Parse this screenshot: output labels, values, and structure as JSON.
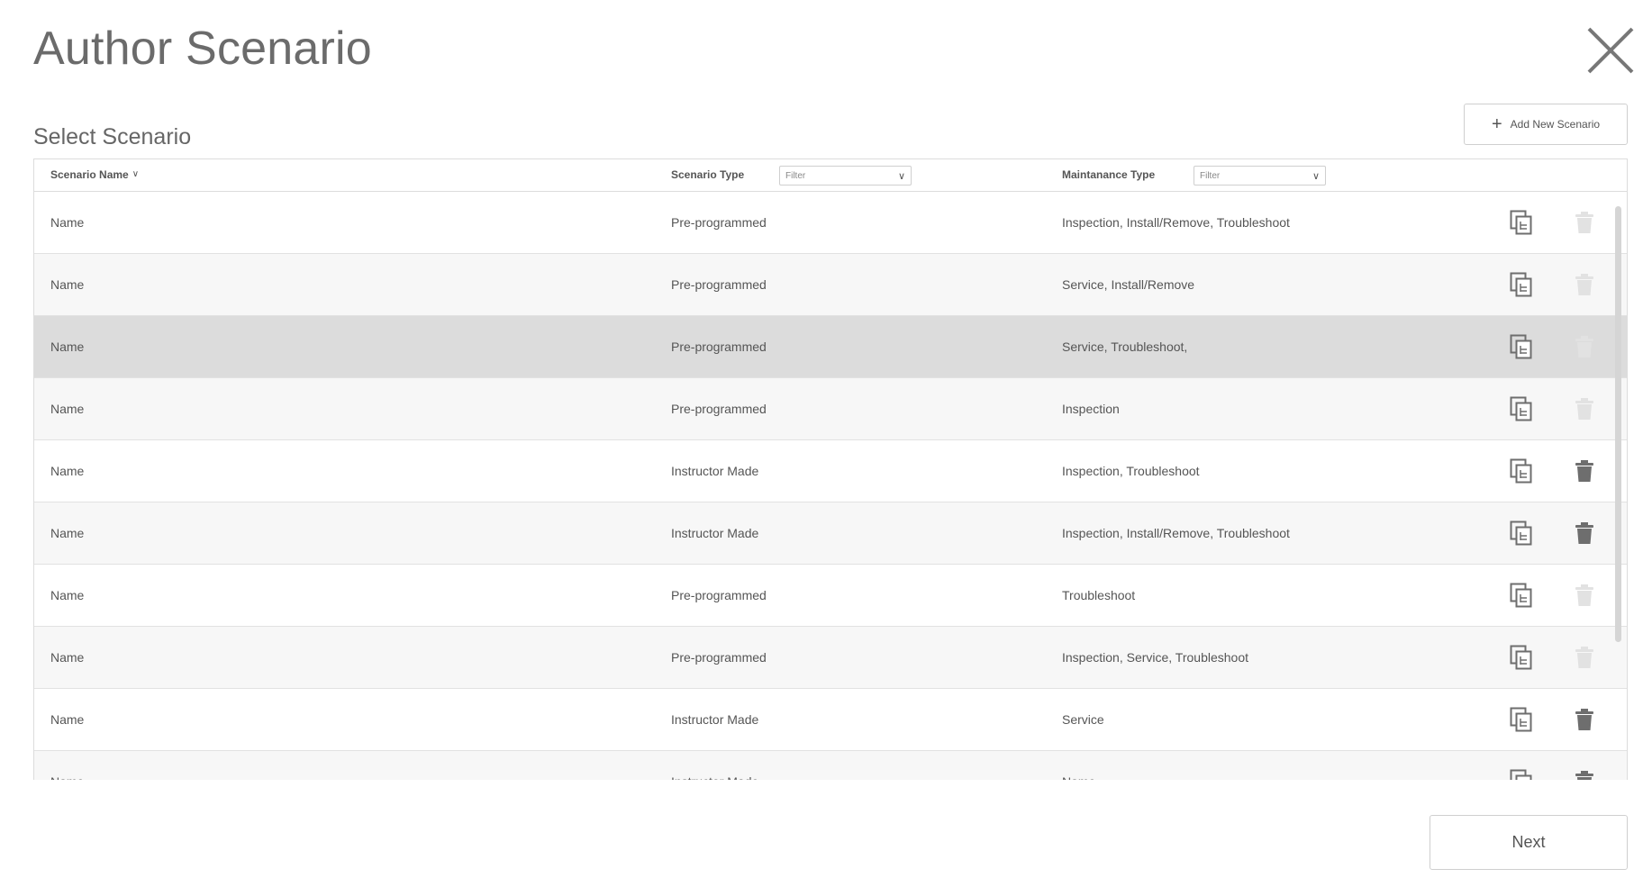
{
  "page": {
    "title": "Author Scenario",
    "section_title": "Select Scenario",
    "add_button_label": "Add New Scenario",
    "next_button_label": "Next"
  },
  "table": {
    "headers": {
      "name": "Scenario Name",
      "type": "Scenario Type",
      "maint": "Maintanance Type"
    },
    "type_filter_placeholder": "Filter",
    "maint_filter_placeholder": "Filter",
    "rows": [
      {
        "name": "Name",
        "type": "Pre-programmed",
        "maint": "Inspection, Install/Remove, Troubleshoot",
        "deletable": false,
        "selected": false
      },
      {
        "name": "Name",
        "type": "Pre-programmed",
        "maint": "Service, Install/Remove",
        "deletable": false,
        "selected": false
      },
      {
        "name": "Name",
        "type": "Pre-programmed",
        "maint": "Service, Troubleshoot,",
        "deletable": false,
        "selected": true
      },
      {
        "name": "Name",
        "type": "Pre-programmed",
        "maint": "Inspection",
        "deletable": false,
        "selected": false
      },
      {
        "name": "Name",
        "type": "Instructor Made",
        "maint": "Inspection, Troubleshoot",
        "deletable": true,
        "selected": false
      },
      {
        "name": "Name",
        "type": "Instructor Made",
        "maint": "Inspection, Install/Remove, Troubleshoot",
        "deletable": true,
        "selected": false
      },
      {
        "name": "Name",
        "type": "Pre-programmed",
        "maint": "Troubleshoot",
        "deletable": false,
        "selected": false
      },
      {
        "name": "Name",
        "type": "Pre-programmed",
        "maint": "Inspection, Service, Troubleshoot",
        "deletable": false,
        "selected": false
      },
      {
        "name": "Name",
        "type": "Instructor Made",
        "maint": "Service",
        "deletable": true,
        "selected": false
      },
      {
        "name": "Name",
        "type": "Instructor Made",
        "maint": "Name",
        "deletable": true,
        "selected": false
      }
    ]
  },
  "icons": {
    "close": "close-icon",
    "add": "plus-icon",
    "sort": "chevron-down-icon",
    "filter_dropdown": "chevron-down-icon",
    "copy": "copy-icon",
    "delete": "trash-icon"
  },
  "colors": {
    "text": "#555555",
    "title": "#6b6b6b",
    "border": "#dcdcdc",
    "row_alt": "#f7f7f7",
    "row_selected": "#dcdcdc",
    "icon": "#6e6e6e",
    "icon_disabled": "#e2e2e2"
  }
}
